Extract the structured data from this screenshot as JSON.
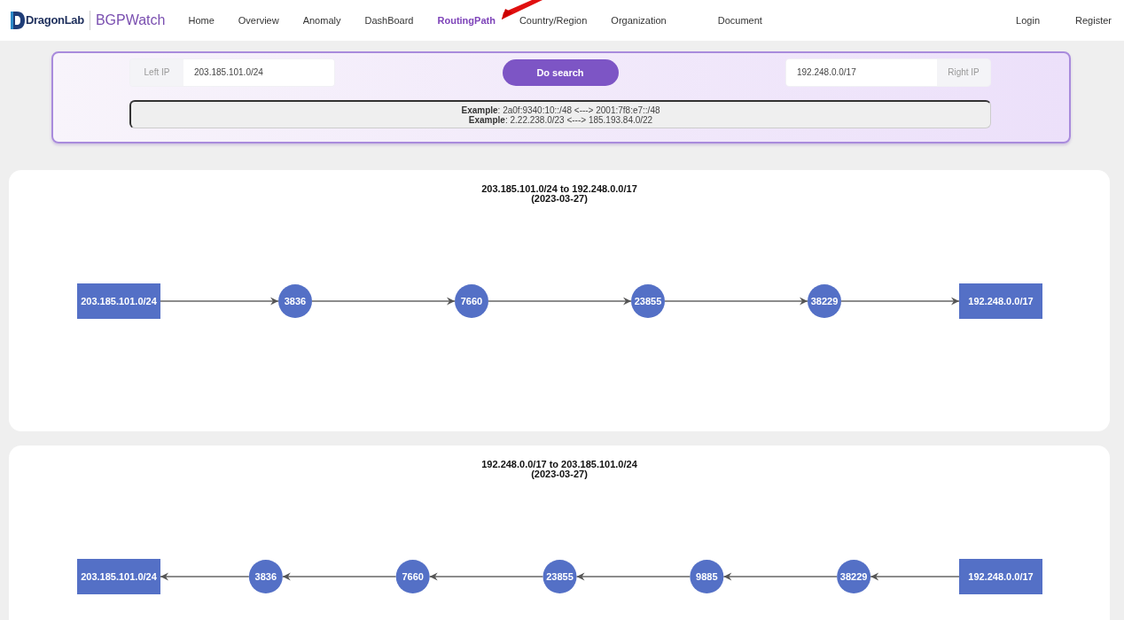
{
  "header": {
    "logo": {
      "brand": "DragonLab",
      "product": "BGPWatch"
    },
    "nav": [
      {
        "label": "Home",
        "selected": false
      },
      {
        "label": "Overview",
        "selected": false
      },
      {
        "label": "Anomaly",
        "selected": false
      },
      {
        "label": "DashBoard",
        "selected": false
      },
      {
        "label": "RoutingPath",
        "selected": true
      },
      {
        "label": "Country/Region",
        "selected": false
      },
      {
        "label": "Organization",
        "selected": false
      },
      {
        "label": "Document",
        "selected": false
      }
    ],
    "account": [
      "Login",
      "Register"
    ]
  },
  "search": {
    "left": {
      "addon": "Left IP",
      "value": "203.185.101.0/24"
    },
    "button": "Do search",
    "right": {
      "value": "192.248.0.0/17",
      "addon": "Right IP"
    },
    "examples": [
      "**Example**: 2a0f:9340:10::/48 <---> 2001:7f8:e7::/48",
      "**Example**: 2.22.238.0/23 <---> 185.193.84.0/22"
    ]
  },
  "paths": [
    {
      "title": "203.185.101.0/24 to 192.248.0.0/17",
      "date": "(2023-03-27)",
      "reversed": false,
      "nodes": [
        {
          "kind": "prefix",
          "label": "203.185.101.0/24"
        },
        {
          "kind": "as",
          "label": "3836"
        },
        {
          "kind": "as",
          "label": "7660"
        },
        {
          "kind": "as",
          "label": "23855"
        },
        {
          "kind": "as",
          "label": "38229"
        },
        {
          "kind": "prefix",
          "label": "192.248.0.0/17"
        }
      ]
    },
    {
      "title": "192.248.0.0/17 to 203.185.101.0/24",
      "date": "(2023-03-27)",
      "reversed": true,
      "nodes": [
        {
          "kind": "prefix",
          "label": "203.185.101.0/24"
        },
        {
          "kind": "as",
          "label": "3836"
        },
        {
          "kind": "as",
          "label": "7660"
        },
        {
          "kind": "as",
          "label": "23855"
        },
        {
          "kind": "as",
          "label": "9885"
        },
        {
          "kind": "as",
          "label": "38229"
        },
        {
          "kind": "prefix",
          "label": "192.248.0.0/17"
        }
      ]
    }
  ]
}
